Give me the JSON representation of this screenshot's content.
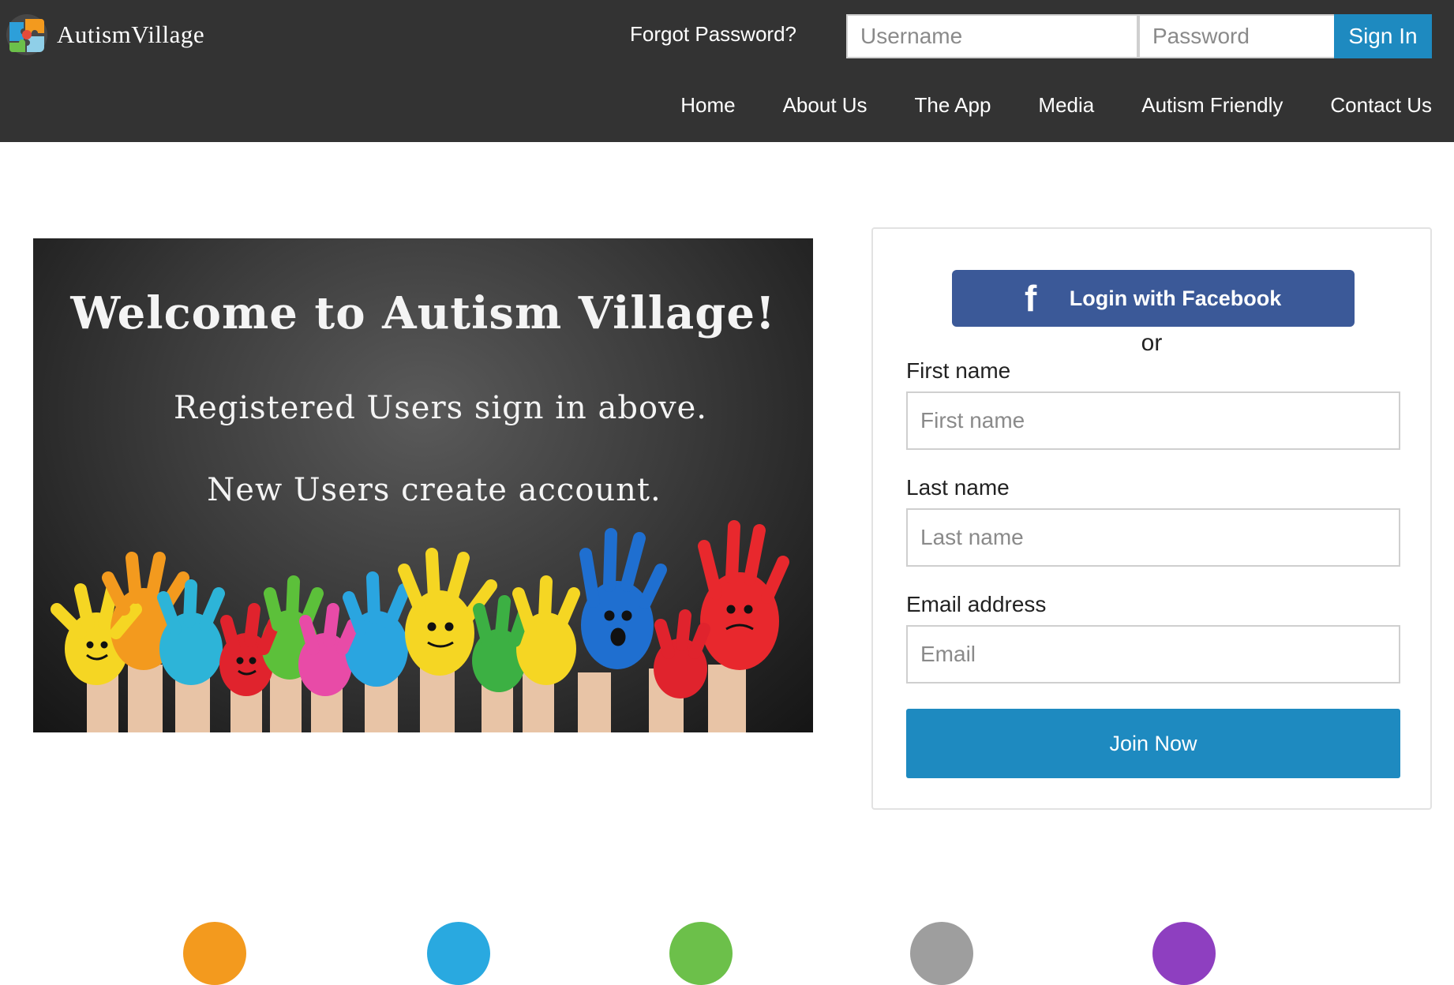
{
  "brand": {
    "name_first": "Autism",
    "name_second": "Village"
  },
  "auth": {
    "forgot_label": "Forgot Password?",
    "username_placeholder": "Username",
    "password_placeholder": "Password",
    "signin_label": "Sign In"
  },
  "nav": {
    "items": [
      {
        "label": "Home"
      },
      {
        "label": "About Us"
      },
      {
        "label": "The App"
      },
      {
        "label": "Media"
      },
      {
        "label": "Autism Friendly"
      },
      {
        "label": "Contact Us"
      }
    ]
  },
  "hero": {
    "title": "Welcome to Autism Village!",
    "line2": "Registered Users sign in above.",
    "line3": "New Users create account."
  },
  "signup": {
    "facebook_label": "Login with Facebook",
    "or_text": "or",
    "first_name_label": "First name",
    "first_name_placeholder": "First name",
    "last_name_label": "Last name",
    "last_name_placeholder": "Last name",
    "email_label": "Email address",
    "email_placeholder": "Email",
    "join_label": "Join Now"
  },
  "colors": {
    "header_bg": "#333333",
    "accent_blue": "#1e8ac0",
    "facebook_blue": "#3b5998",
    "circle_colors": [
      "#f39a1e",
      "#29a9e0",
      "#6cc04a",
      "#9e9e9e",
      "#8e3fc0"
    ]
  },
  "icons": {
    "logo": "puzzle-globe-icon",
    "facebook": "facebook-f-icon"
  }
}
